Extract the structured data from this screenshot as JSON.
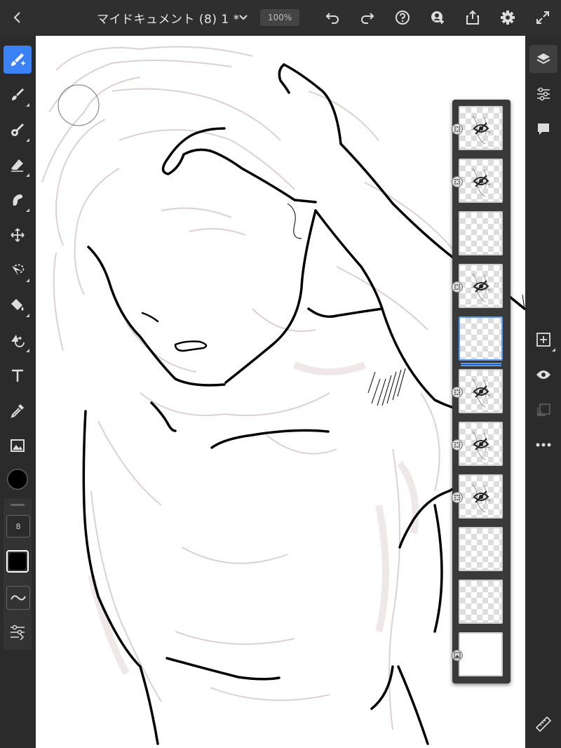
{
  "header": {
    "title": "マイドキュメント (8) 1 *",
    "zoom": "100%"
  },
  "left_tools": [
    {
      "name": "brush-tool-icon",
      "active": true
    },
    {
      "name": "pixel-brush-icon"
    },
    {
      "name": "mixer-brush-icon"
    },
    {
      "name": "eraser-icon"
    },
    {
      "name": "smudge-icon"
    },
    {
      "name": "move-icon"
    },
    {
      "name": "lasso-icon"
    },
    {
      "name": "fill-icon"
    },
    {
      "name": "transform-icon"
    },
    {
      "name": "text-icon"
    },
    {
      "name": "eyedropper-icon"
    },
    {
      "name": "image-icon"
    }
  ],
  "brush": {
    "color": "#000000",
    "size": "8",
    "opacity_color": "#000000"
  },
  "layers": [
    {
      "hidden": true,
      "group": true
    },
    {
      "hidden": true,
      "group": true
    },
    {
      "hidden": false,
      "group": false
    },
    {
      "hidden": true,
      "group": true
    },
    {
      "hidden": false,
      "group": false,
      "selected": true
    },
    {
      "hidden": true,
      "group": true
    },
    {
      "hidden": true,
      "group": true
    },
    {
      "hidden": true,
      "group": true
    },
    {
      "hidden": false,
      "group": false
    },
    {
      "hidden": false,
      "group": false
    },
    {
      "hidden": false,
      "group": false,
      "background": true
    }
  ],
  "colors": {
    "accent": "#3b82f6",
    "selected_layer": "#5b9cf5",
    "sketch": "#d9c9c9",
    "ink": "#000000"
  }
}
